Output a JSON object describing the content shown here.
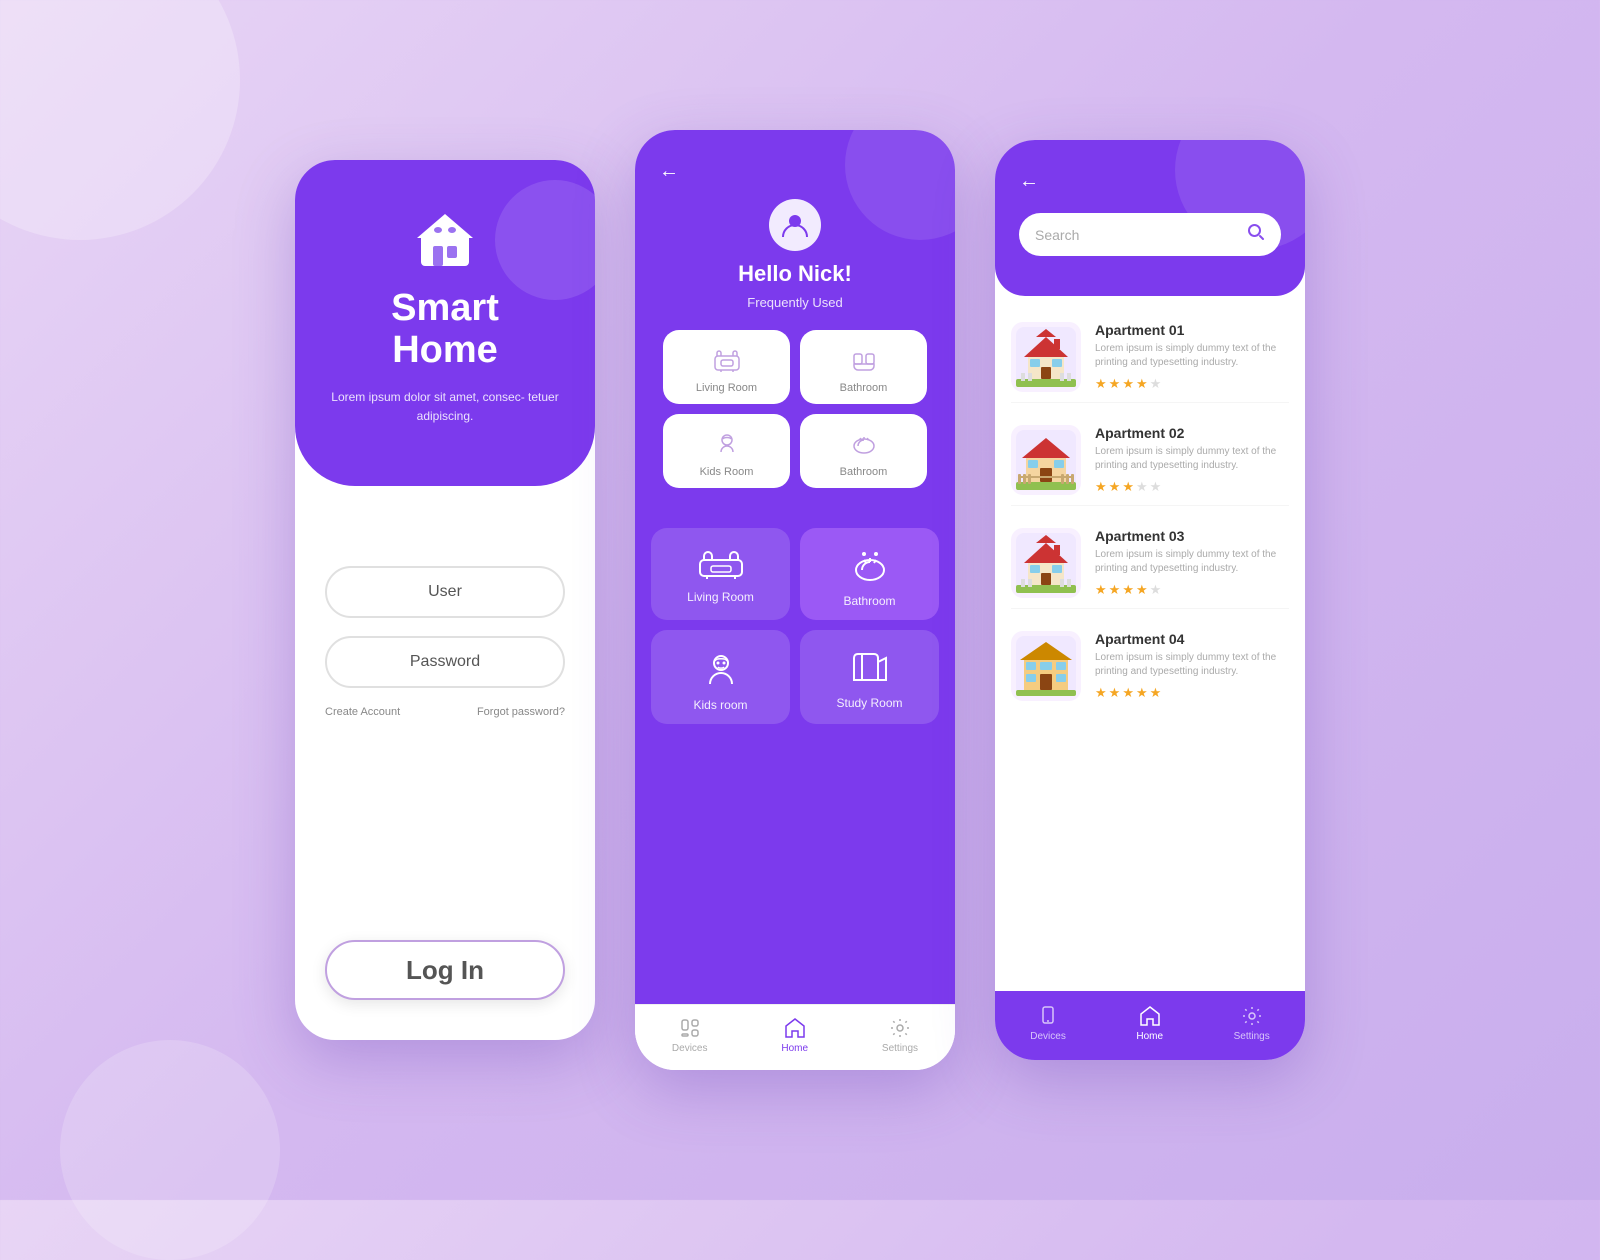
{
  "app": {
    "name": "Smart Home",
    "tagline": "Lorem ipsum dolor sit amet, consec-\ntetuer adipiscing."
  },
  "login": {
    "title_line1": "Smart",
    "title_line2": "Home",
    "user_placeholder": "User",
    "password_placeholder": "Password",
    "create_account": "Create Account",
    "forgot_password": "Forgot password?",
    "login_btn": "Log In"
  },
  "home": {
    "greeting": "Hello Nick!",
    "frequently_used": "Frequently Used",
    "freq_rooms": [
      {
        "label": "Living Room"
      },
      {
        "label": "Bathroom"
      },
      {
        "label": "Kids Room"
      },
      {
        "label": "Bathroom"
      }
    ],
    "rooms": [
      {
        "label": "Living Room"
      },
      {
        "label": "Bathroom"
      },
      {
        "label": "Kids room"
      },
      {
        "label": "Study Room"
      }
    ]
  },
  "nav": {
    "devices": "Devices",
    "home": "Home",
    "settings": "Settings"
  },
  "search": {
    "placeholder": "Search",
    "apartments": [
      {
        "name": "Apartment 01",
        "desc": "Lorem ipsum is simply dummy text of the printing and typesetting industry.",
        "stars": [
          1,
          1,
          1,
          1,
          0
        ]
      },
      {
        "name": "Apartment 02",
        "desc": "Lorem ipsum is simply dummy text of the printing and typesetting industry.",
        "stars": [
          1,
          1,
          1,
          0,
          0
        ]
      },
      {
        "name": "Apartment 03",
        "desc": "Lorem ipsum is simply dummy text of the printing and typesetting industry.",
        "stars": [
          1,
          1,
          1,
          1,
          0
        ]
      },
      {
        "name": "Apartment 04",
        "desc": "Lorem ipsum is simply dummy text of the printing and typesetting industry.",
        "stars": [
          1,
          1,
          1,
          1,
          1
        ]
      }
    ]
  }
}
